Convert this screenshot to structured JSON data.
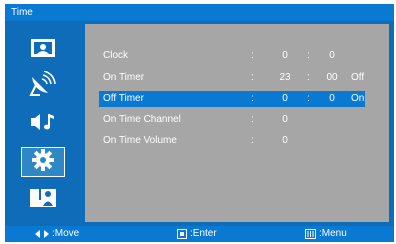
{
  "window": {
    "title": "Time"
  },
  "sidebar": {
    "items": [
      {
        "icon": "picture-icon",
        "active": false
      },
      {
        "icon": "satellite-dish-icon",
        "active": false
      },
      {
        "icon": "sound-icon",
        "active": false
      },
      {
        "icon": "gear-icon",
        "active": true
      },
      {
        "icon": "person-icon",
        "active": false
      }
    ]
  },
  "menu": {
    "rows": [
      {
        "label": "Clock",
        "colon": ":",
        "value1": "0",
        "sep": ":",
        "value2": "0",
        "value3": ""
      },
      {
        "label": "On Timer",
        "colon": ":",
        "value1": "23",
        "sep": ":",
        "value2": "00",
        "value3": "Off"
      },
      {
        "label": "Off Timer",
        "colon": ":",
        "value1": "0",
        "sep": ":",
        "value2": "0",
        "value3": "On",
        "selected": true
      },
      {
        "label": "On Time Channel",
        "colon": ":",
        "value1": "0",
        "sep": "",
        "value2": "",
        "value3": ""
      },
      {
        "label": "On Time Volume",
        "colon": ":",
        "value1": "0",
        "sep": "",
        "value2": "",
        "value3": ""
      }
    ]
  },
  "bottom": {
    "move_label": ":Move",
    "enter_label": ":Enter",
    "menu_label": ":Menu"
  },
  "colors": {
    "frame": "#0f6cb8",
    "highlight": "#0a79d1",
    "panel": "#a6a6a6"
  }
}
